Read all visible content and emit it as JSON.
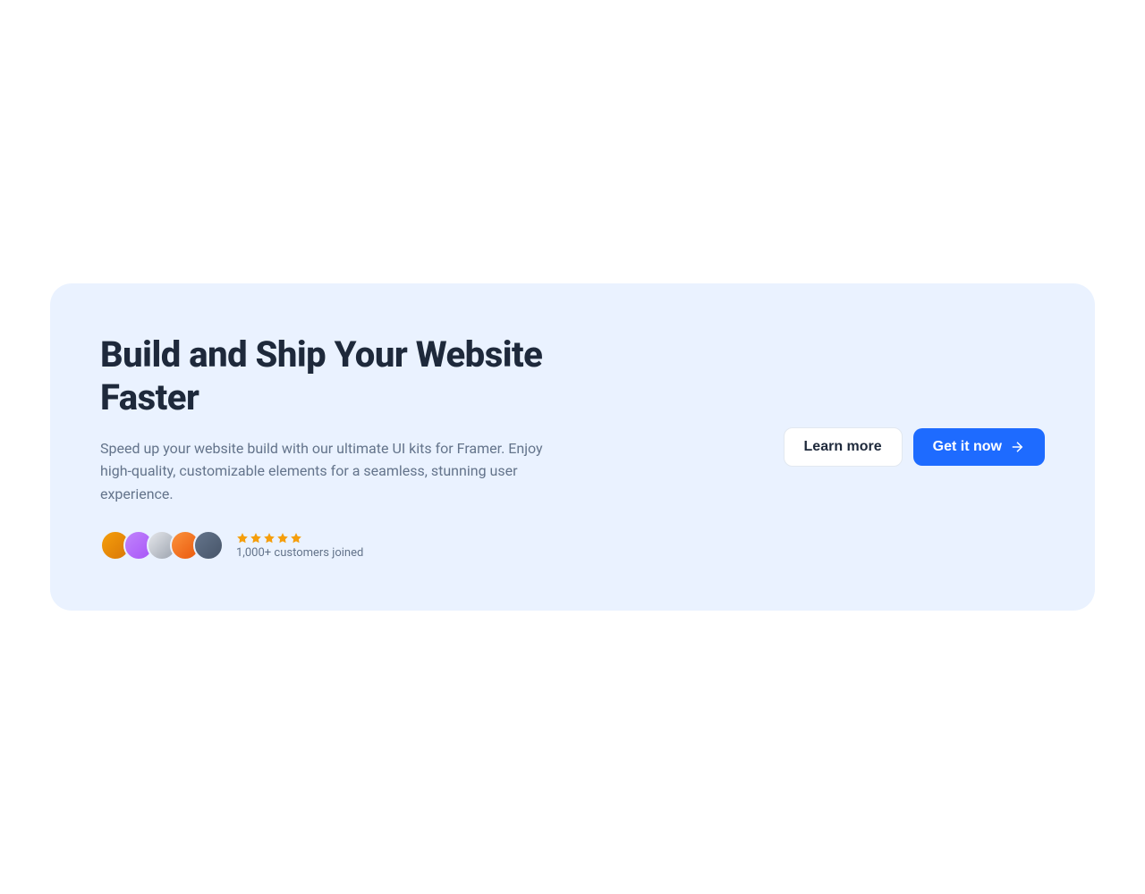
{
  "cta": {
    "heading": "Build and Ship Your Website Faster",
    "description": "Speed up your website build with our ultimate UI kits for Framer. Enjoy high-quality, customizable elements for a seamless, stunning user experience.",
    "social_proof": {
      "stars": 5,
      "customers_text": "1,000+ customers joined",
      "avatar_count": 5
    },
    "buttons": {
      "secondary_label": "Learn more",
      "primary_label": "Get it now"
    }
  },
  "colors": {
    "card_bg": "#eaf2ff",
    "primary": "#1e6bff",
    "star": "#f59e0b",
    "text_dark": "#1e293b",
    "text_muted": "#64748b"
  }
}
